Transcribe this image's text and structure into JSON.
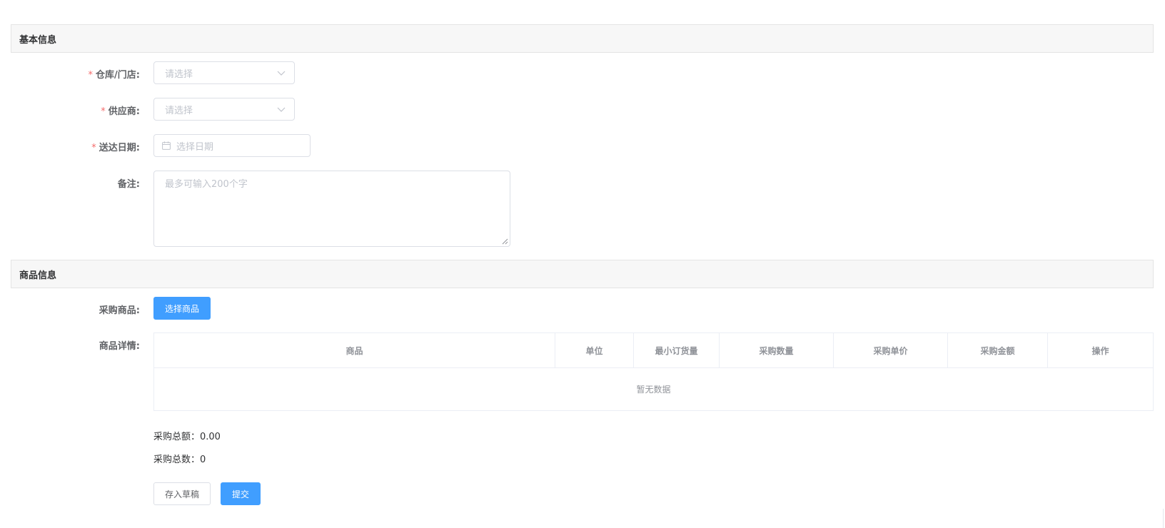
{
  "sections": {
    "basic": "基本信息",
    "goods": "商品信息"
  },
  "form": {
    "warehouse": {
      "label": "仓库/门店:",
      "required": "*",
      "placeholder": "请选择"
    },
    "supplier": {
      "label": "供应商:",
      "required": "*",
      "placeholder": "请选择"
    },
    "delivery_date": {
      "label": "送达日期:",
      "required": "*",
      "placeholder": "选择日期"
    },
    "remark": {
      "label": "备注:",
      "placeholder": "最多可输入200个字"
    },
    "purchase_goods": {
      "label": "采购商品:",
      "button": "选择商品"
    },
    "goods_detail": {
      "label": "商品详情:"
    }
  },
  "table": {
    "columns": [
      "商品",
      "单位",
      "最小订货量",
      "采购数量",
      "采购单价",
      "采购金额",
      "操作"
    ],
    "empty_text": "暂无数据"
  },
  "summary": {
    "total_amount": "采购总额：0.00",
    "total_count": "采购总数：0"
  },
  "actions": {
    "draft": "存入草稿",
    "submit": "提交"
  },
  "colors": {
    "primary": "#409eff",
    "required": "#f56c6c"
  },
  "icons": {
    "select_arrow": "chevron-down-icon",
    "date": "calendar-icon"
  }
}
